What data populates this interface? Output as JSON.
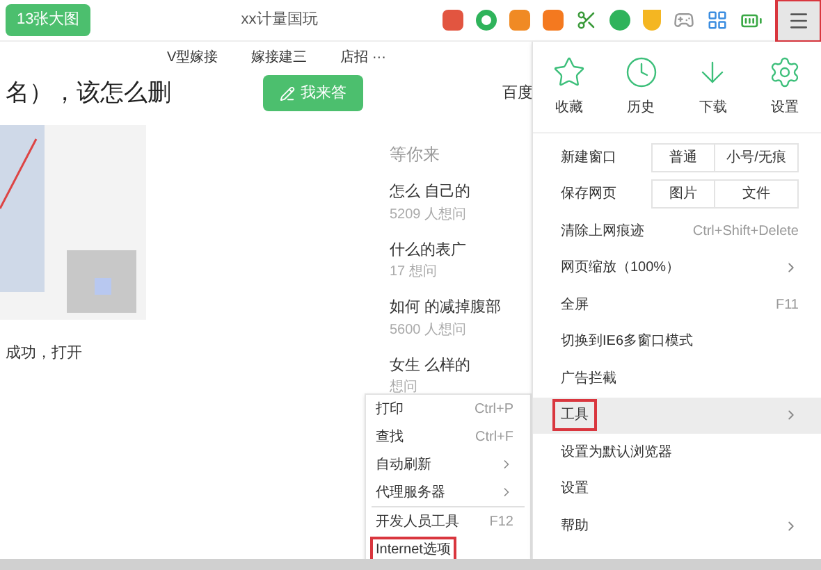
{
  "toolbar": {
    "badge": "13张大图",
    "title": "xx计量国玩"
  },
  "bookmarks": [
    {
      "label": "V型嫁接"
    },
    {
      "label": "嫁接建三"
    },
    {
      "label": "店招 ···"
    }
  ],
  "question": {
    "title": "名），该怎么删",
    "answer_button": "我来答",
    "side_link": "百度"
  },
  "article": {
    "text": "成功，打开"
  },
  "sidebar": {
    "heading": "等你来",
    "items": [
      {
        "title": "怎么 自己的",
        "meta": "5209 人想问"
      },
      {
        "title": "什么的表广",
        "meta": "17 想问"
      },
      {
        "title": "如何 的减掉腹部",
        "meta": "5600 人想问"
      },
      {
        "title": "女生 么样的",
        "meta": "想问"
      }
    ]
  },
  "menu": {
    "button_highlighted": true,
    "shortcuts": [
      {
        "kind": "star",
        "label": "收藏"
      },
      {
        "kind": "clock",
        "label": "历史"
      },
      {
        "kind": "download",
        "label": "下载"
      },
      {
        "kind": "gear",
        "label": "设置"
      }
    ],
    "items": [
      {
        "label": "新建窗口",
        "kind": "buttons",
        "buttons": [
          "普通",
          "小号/无痕"
        ],
        "highlighted": false
      },
      {
        "label": "保存网页",
        "kind": "buttons",
        "buttons": [
          "图片",
          "文件"
        ],
        "highlighted": false
      },
      {
        "label": "清除上网痕迹",
        "kind": "shortcut",
        "shortcut": "Ctrl+Shift+Delete",
        "highlighted": false
      },
      {
        "label": "网页缩放（100%）",
        "kind": "submenu",
        "highlighted": false
      },
      {
        "label": "全屏",
        "kind": "shortcut",
        "shortcut": "F11",
        "highlighted": false
      },
      {
        "label": "切换到IE6多窗口模式",
        "kind": "plain",
        "highlighted": false
      },
      {
        "label": "广告拦截",
        "kind": "plain",
        "highlighted": false
      },
      {
        "label": "工具",
        "kind": "submenu",
        "highlighted": true
      },
      {
        "label": "设置为默认浏览器",
        "kind": "plain",
        "highlighted": false
      },
      {
        "label": "设置",
        "kind": "plain",
        "highlighted": false
      },
      {
        "label": "帮助",
        "kind": "submenu",
        "highlighted": false
      }
    ]
  },
  "submenu": {
    "items": [
      {
        "label": "打印",
        "kind": "shortcut",
        "shortcut": "Ctrl+P",
        "highlighted": false
      },
      {
        "label": "查找",
        "kind": "shortcut",
        "shortcut": "Ctrl+F",
        "highlighted": false
      },
      {
        "label": "自动刷新",
        "kind": "submenu",
        "highlighted": false
      },
      {
        "label": "代理服务器",
        "kind": "submenu",
        "highlighted": false
      },
      {
        "label": "开发人员工具",
        "kind": "shortcut",
        "shortcut": "F12",
        "highlighted": false,
        "divider_before": true
      },
      {
        "label": "Internet选项",
        "kind": "plain",
        "highlighted": true
      }
    ]
  }
}
